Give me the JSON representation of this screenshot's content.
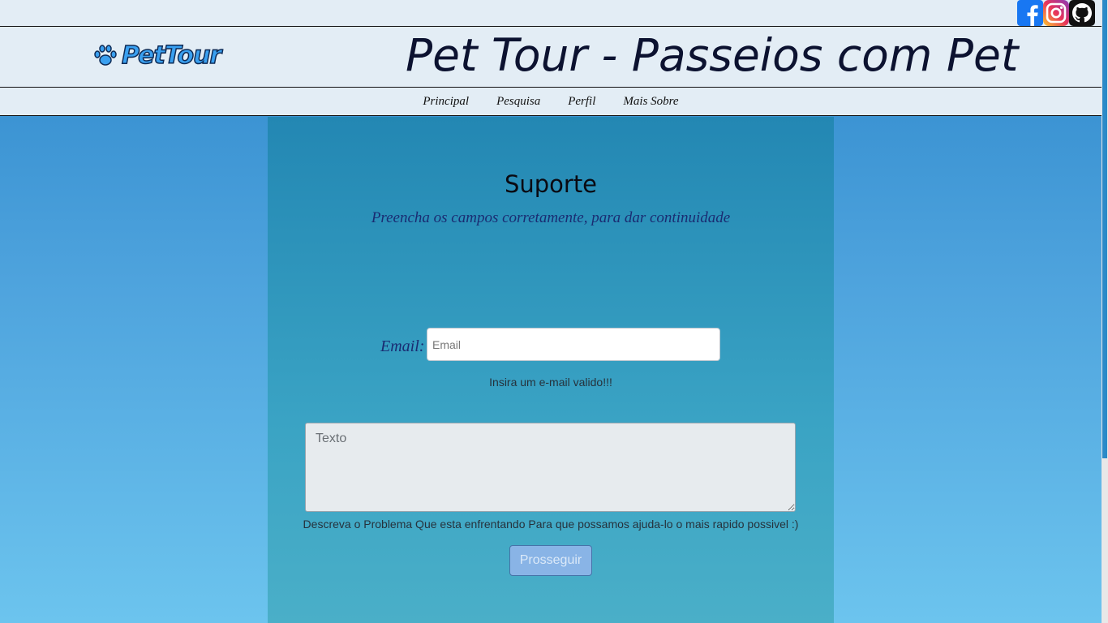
{
  "social": {
    "facebook_icon": "facebook-icon",
    "instagram_icon": "instagram-icon",
    "github_icon": "github-icon"
  },
  "header": {
    "logo_text": "PetTour",
    "title": "Pet Tour - Passeios com Pet"
  },
  "nav": {
    "items": [
      {
        "label": "Principal"
      },
      {
        "label": "Pesquisa"
      },
      {
        "label": "Perfil"
      },
      {
        "label": "Mais Sobre"
      }
    ]
  },
  "form": {
    "heading": "Suporte",
    "subtitle": "Preencha os campos corretamente, para dar continuidade",
    "email_label": "Email:",
    "email_placeholder": "Email",
    "email_help": "Insira um e-mail valido!!!",
    "text_placeholder": "Texto",
    "text_help": "Descreva o Problema Que esta enfrentando Para que possamos ajuda-lo o mais rapido possivel :)",
    "submit_label": "Prosseguir"
  },
  "colors": {
    "header_bg": "#e3edf5",
    "title_color": "#0c1230",
    "panel_bg": "#2387b3",
    "accent_italic": "#1a2c72",
    "submit_bg": "#89b4e6"
  }
}
